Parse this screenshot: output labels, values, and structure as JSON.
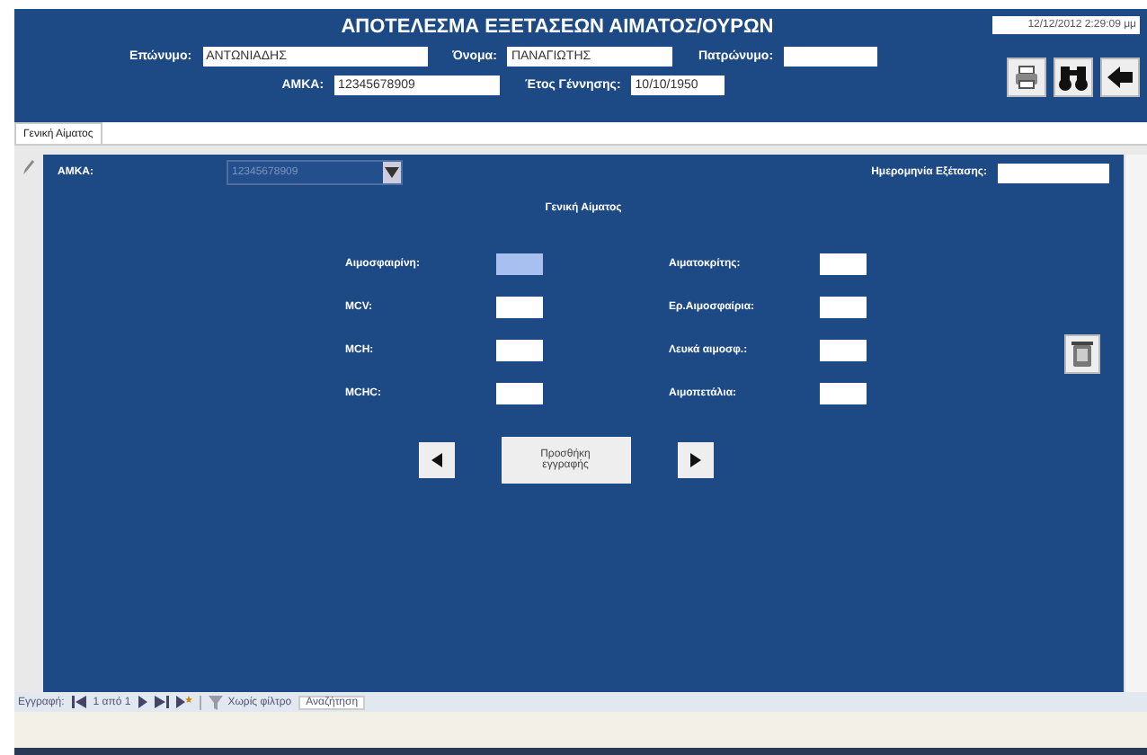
{
  "header": {
    "title": "ΑΠΟΤΕΛΕΣΜΑ ΕΞΕΤΑΣΕΩΝ ΑΙΜΑΤΟΣ/ΟΥΡΩΝ",
    "datetime": "12/12/2012 2:29:09 μμ",
    "fields_row1": [
      {
        "label": "Επώνυμο:",
        "value": "ΑΝΤΩΝΙΑΔΗΣ"
      },
      {
        "label": "Όνομα:",
        "value": "ΠΑΝΑΓΙΩΤΗΣ"
      },
      {
        "label": "Πατρώνυμο:"
      }
    ],
    "fields_row2": [
      {
        "label": "ΑΜΚΑ:",
        "value": "12345678909"
      },
      {
        "label": "Έτος Γέννησης:",
        "value": "10/10/1950"
      }
    ]
  },
  "tabs": [
    {
      "label": "Γενική Αίματος",
      "selected": true
    }
  ],
  "form": {
    "amka_label": "ΑΜΚΑ:",
    "amka_value": "12345678909",
    "date_label": "Ημερομηνία Εξέτασης:",
    "section_title": "Γενική Αίματος",
    "left_fields": [
      {
        "label": "Αιμοσφαιρίνη:",
        "focused": true
      },
      {
        "label": "MCV:",
        "focused": false
      },
      {
        "label": "MCH:",
        "focused": false
      },
      {
        "label": "MCHC:",
        "focused": false
      }
    ],
    "right_fields": [
      {
        "label": "Αιματοκρίτης:"
      },
      {
        "label": "Ερ.Αιμοσφαίρια:"
      },
      {
        "label": "Λευκά αιμοσφ.:"
      },
      {
        "label": "Αιμοπετάλια:"
      }
    ],
    "add_button": "Προσθήκη εγγραφής"
  },
  "navigator": {
    "label": "Εγγραφή:",
    "position": "1 από 1",
    "filter": "Χωρίς φίλτρο",
    "search": "Αναζήτηση"
  }
}
